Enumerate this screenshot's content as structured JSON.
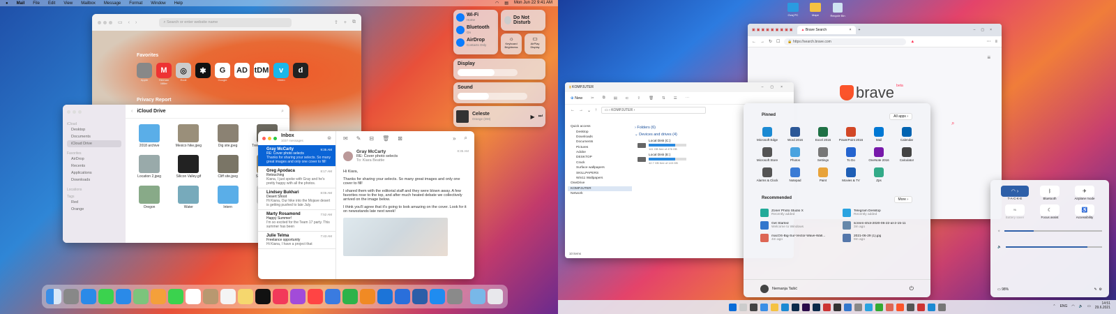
{
  "mac": {
    "menubar": {
      "items": [
        "Mail",
        "File",
        "Edit",
        "View",
        "Mailbox",
        "Message",
        "Format",
        "Window",
        "Help"
      ],
      "clock": "Mon Jun 22  9:41 AM"
    },
    "safari": {
      "search_placeholder": "Search or enter website name",
      "favorites_title": "Favorites",
      "privacy_title": "Privacy Report",
      "favorites": [
        {
          "glyph": "",
          "label": "Apple",
          "color": "#888"
        },
        {
          "glyph": "M",
          "label": "Herman Miller",
          "color": "#e33"
        },
        {
          "glyph": "◎",
          "label": "Ecoli",
          "color": "#ccc"
        },
        {
          "glyph": "✱",
          "label": "",
          "color": "#111"
        },
        {
          "glyph": "G",
          "label": "Google",
          "color": "#fff"
        },
        {
          "glyph": "AD",
          "label": "",
          "color": "#fff"
        },
        {
          "glyph": "tDM",
          "label": "",
          "color": "#fff"
        },
        {
          "glyph": "v",
          "label": "Vimeo",
          "color": "#1ab7ea"
        },
        {
          "glyph": "d",
          "label": "",
          "color": "#222"
        }
      ]
    },
    "control_center": {
      "wifi": "Wi-Fi",
      "wifi_sub": "Home",
      "bluetooth": "Bluetooth",
      "bluetooth_sub": "On",
      "airdrop": "AirDrop",
      "airdrop_sub": "Contacts Only",
      "dnd": "Do Not Disturb",
      "kb": "Keyboard Brightness",
      "airplay": "AirPlay Display",
      "display": "Display",
      "display_level": 0.62,
      "sound": "Sound",
      "sound_level": 0.45,
      "np_title": "Celeste",
      "np_artist": "Orange (DM)"
    },
    "finder": {
      "title": "iCloud Drive",
      "sidebar_h1": "iCloud",
      "sidebar": [
        "Desktop",
        "Documents",
        "iCloud Drive"
      ],
      "sidebar_h2": "Favorites",
      "sidebar2": [
        "AirDrop",
        "Recents",
        "Applications",
        "Downloads"
      ],
      "sidebar_h3": "Locations",
      "sidebar_h4": "Tags",
      "tags": [
        "Red",
        "Orange"
      ],
      "files": [
        {
          "name": "2018 archive",
          "color": "#5aaee8"
        },
        {
          "name": "Mexico hike.jpeg",
          "color": "#9a8f7a"
        },
        {
          "name": "Dig site.jpeg",
          "color": "#8b8273"
        },
        {
          "name": "Tree specimen.jpeg",
          "color": "#6d6a60"
        },
        {
          "name": "Location 2.jpeg",
          "color": "#9aa"
        },
        {
          "name": "Silicon Valley.gif",
          "color": "#222"
        },
        {
          "name": "Cliff site.jpeg",
          "color": "#7a7566"
        },
        {
          "name": "Sandy hill.jpeg",
          "color": "#b0a080"
        },
        {
          "name": "Oregon",
          "color": "#8a8"
        },
        {
          "name": "Water",
          "color": "#7ab"
        },
        {
          "name": "Intern",
          "color": "#5aaee8"
        },
        {
          "name": "Interview",
          "color": "#ddd"
        }
      ]
    },
    "mail": {
      "title": "Inbox",
      "count": "1037 messages",
      "list": [
        {
          "name": "Gray McCarty",
          "subject": "RE: Cover photo selects",
          "preview": "Thanks for sharing your selects. So many great images and only one cover to fill!",
          "time": "9:35 AM",
          "selected": true
        },
        {
          "name": "Greg Apodaca",
          "subject": "Retouching",
          "preview": "Kiana, I just spoke with Gray and he's pretty happy with all the photos.",
          "time": "8:17 AM"
        },
        {
          "name": "Lindsey Bukhari",
          "subject": "Desert Shoot",
          "preview": "Hi Kiana, Our hike into the Mojave desert is getting pushed to late July.",
          "time": "8:05 AM"
        },
        {
          "name": "Marty Rosamond",
          "subject": "Happy Summer!",
          "preview": "I'm so excited for the Team 17 party. This summer has been",
          "time": "7:52 AM"
        },
        {
          "name": "Julie Telma",
          "subject": "Freelance opportunity",
          "preview": "Hi Kiana, I have a project that",
          "time": "7:43 AM"
        }
      ],
      "from": "Gray McCarty",
      "subject": "RE: Cover photo selects",
      "to_label": "To:",
      "to": "Kiara Beattie",
      "time": "8:35 AM",
      "body": [
        "Hi Kiara,",
        "Thanks for sharing your selects. So many great images and only one cover to fill!",
        "I shared them with the editorial staff and they were blown away. A few favorites rose to the top, and after much heated debate we collectively arrived on the image below.",
        "I think you'll agree that it's going to look amazing on the cover. Look for it on newsstands late next week!"
      ]
    }
  },
  "win": {
    "desktop_icons": [
      "Ovaj PC",
      "Mape",
      "Recycle Bin"
    ],
    "browser": {
      "tab": "Brave Search",
      "url": "https://search.brave.com",
      "logo": "brave",
      "beta": "beta"
    },
    "explorer": {
      "title": "KOMPJUTER",
      "new": "New",
      "path": "KOMPJUTER",
      "folders": "Folders (6)",
      "devices": "Devices and drives (4)",
      "sidebar": [
        "Quick access",
        "Desktop",
        "Downloads",
        "Documents",
        "Pictures",
        "Adobe",
        "DESKTOP",
        "Crack",
        "Surface wallpapers",
        "SKILLPAPERS",
        "Win11 Wallpapers",
        "OneDrive",
        "KOMPJUTER",
        "Network"
      ],
      "drives": [
        {
          "name": "Local Disk (C:)",
          "free": "141 GB free of 476 GB",
          "used": 0.7
        },
        {
          "name": "Local Disk (E:)",
          "free": "42.7 GB free of 143 GB",
          "used": 0.7
        }
      ],
      "status": "10 items"
    },
    "start": {
      "pinned": "Pinned",
      "all_apps": "All apps",
      "recommended": "Recommended",
      "more": "More",
      "user": "Nemanja Tašić",
      "apps": [
        {
          "n": "Microsoft Edge",
          "c": "#1b8ad3"
        },
        {
          "n": "Word 2016",
          "c": "#2b5797"
        },
        {
          "n": "Excel 2016",
          "c": "#1e7145"
        },
        {
          "n": "PowerPoint 2016",
          "c": "#d24726"
        },
        {
          "n": "Mail",
          "c": "#0078d4"
        },
        {
          "n": "Calendar",
          "c": "#0063b1"
        },
        {
          "n": "Microsoft Store",
          "c": "#555"
        },
        {
          "n": "Photos",
          "c": "#4aa3df"
        },
        {
          "n": "Settings",
          "c": "#777"
        },
        {
          "n": "To Do",
          "c": "#2564cf"
        },
        {
          "n": "OneNote 2016",
          "c": "#7719aa"
        },
        {
          "n": "Calculator",
          "c": "#444"
        },
        {
          "n": "Alarms & Clock",
          "c": "#555"
        },
        {
          "n": "Notepad",
          "c": "#3a7bd5"
        },
        {
          "n": "Paint",
          "c": "#e8a33a"
        },
        {
          "n": "Movies & TV",
          "c": "#1e5eb5"
        },
        {
          "n": "Zps",
          "c": "#3a8"
        }
      ],
      "rec": [
        {
          "n": "Zoner Photo Studio X",
          "s": "Recently added",
          "c": "#2a9"
        },
        {
          "n": "Telegram Desktop",
          "s": "Recently added",
          "c": "#2aa3e0"
        },
        {
          "n": "Get Started",
          "s": "Welcome to Windows",
          "c": "#37c"
        },
        {
          "n": "screen-shot-2020-06-22-at-2-15-11",
          "s": "3m ago",
          "c": "#68a"
        },
        {
          "n": "macOS-Big-Sur-Vector-Wave-Wall...",
          "s": "4m ago",
          "c": "#d65"
        },
        {
          "n": "2021-06-29 (1).jpg",
          "s": "9m ago",
          "c": "#57a"
        }
      ]
    },
    "quick": {
      "wifi": "T-A-C-K-E",
      "bluetooth": "Bluetooth",
      "airplane": "Airplane mode",
      "battery": "Battery saver",
      "focus": "Focus assist",
      "access": "Accessibility",
      "battery_pct": "98%",
      "brightness": 0.3,
      "volume": 0.85
    },
    "tray": {
      "lang": "ENG",
      "time": "14:51",
      "date": "29.6.2021"
    }
  }
}
